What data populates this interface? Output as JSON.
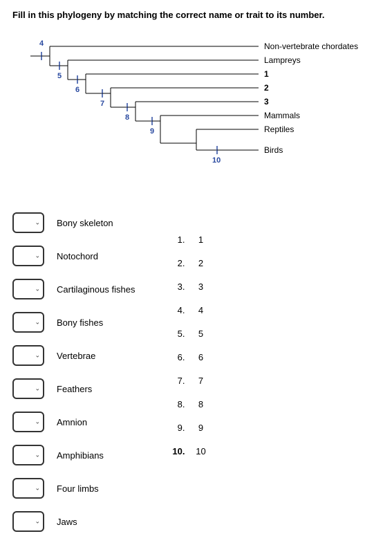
{
  "instruction": "Fill in this phylogeny by matching the correct name or trait to its number.",
  "phylogeny": {
    "tips": [
      {
        "label": "Non-vertebrate chordates",
        "bold": false
      },
      {
        "label": "Lampreys",
        "bold": false
      },
      {
        "label": "1",
        "bold": true
      },
      {
        "label": "2",
        "bold": true
      },
      {
        "label": "3",
        "bold": true
      },
      {
        "label": "Mammals",
        "bold": false
      },
      {
        "label": "Reptiles",
        "bold": false
      },
      {
        "label": "Birds",
        "bold": false
      }
    ],
    "nodes": [
      "4",
      "5",
      "6",
      "7",
      "8",
      "9",
      "10"
    ]
  },
  "traits": [
    "Bony skeleton",
    "Notochord",
    "Cartilaginous fishes",
    "Bony fishes",
    "Vertebrae",
    "Feathers",
    "Amnion",
    "Amphibians",
    "Four limbs",
    "Jaws"
  ],
  "key": [
    {
      "num": "1.",
      "val": "1"
    },
    {
      "num": "2.",
      "val": "2"
    },
    {
      "num": "3.",
      "val": "3"
    },
    {
      "num": "4.",
      "val": "4"
    },
    {
      "num": "5.",
      "val": "5"
    },
    {
      "num": "6.",
      "val": "6"
    },
    {
      "num": "7.",
      "val": "7"
    },
    {
      "num": "8.",
      "val": "8"
    },
    {
      "num": "9.",
      "val": "9"
    },
    {
      "num": "10.",
      "val": "10"
    }
  ]
}
